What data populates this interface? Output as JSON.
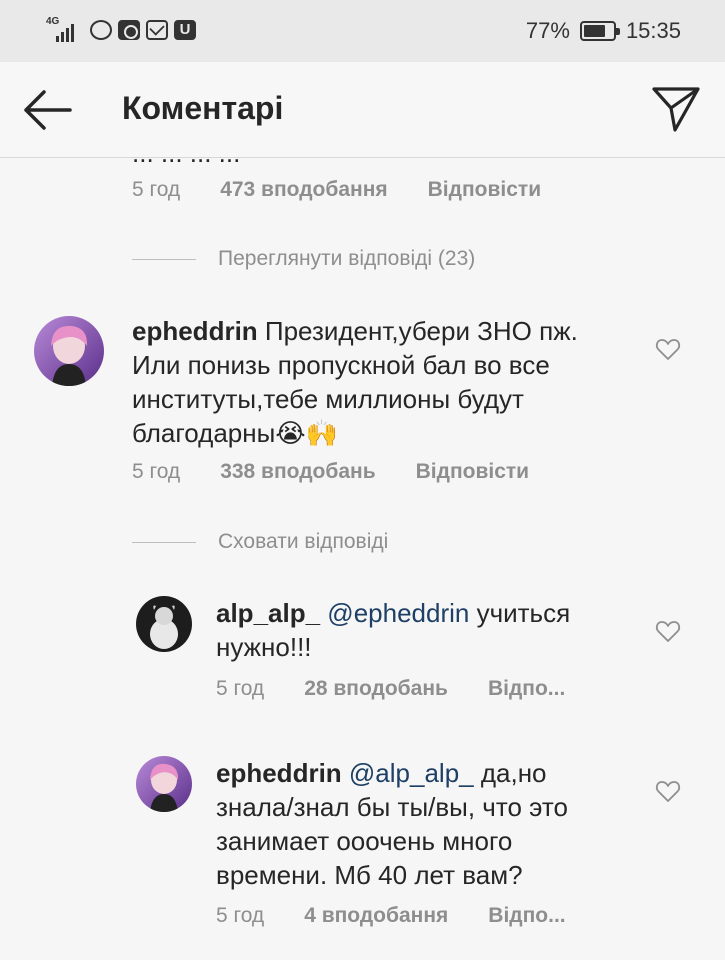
{
  "status_bar": {
    "network": "4G",
    "battery_percent": "77%",
    "battery_level": 0.77,
    "time": "15:35",
    "icons": [
      "signal-icon",
      "emoji-notification-icon",
      "ok-notification-icon",
      "mail-notification-icon",
      "u-notification-icon"
    ]
  },
  "header": {
    "title": "Коментарі",
    "back_icon": "arrow-left-icon",
    "send_icon": "paper-plane-icon"
  },
  "top_cut_comment": {
    "text_fragment": "... ... ... ...",
    "time": "5 год",
    "likes": "473 вподобання",
    "reply": "Відповісти"
  },
  "view_replies_label": "Переглянути відповіді (23)",
  "hide_replies_label": "Сховати відповіді",
  "comments": [
    {
      "username": "epheddrin",
      "text": "Президент,убери ЗНО  пж. Или понизь пропускной бал во все институты,тебе миллионы будут благодарны😭🙌",
      "time": "5 год",
      "likes": "338 вподобань",
      "reply": "Відповісти"
    }
  ],
  "replies": [
    {
      "username": "alp_alp_",
      "mention": "@epheddrin",
      "text": " учиться нужно!!!",
      "time": "5 год",
      "likes": "28 вподобань",
      "reply": "Відпо..."
    },
    {
      "username": "epheddrin",
      "mention": "@alp_alp_",
      "text": " да,но знала/знал бы ты/вы, что это занимает ооочень много времени. Мб 40 лет вам?",
      "time": "5 год",
      "likes": "4 вподобання",
      "reply": "Відпо..."
    }
  ],
  "colors": {
    "status_bar_bg": "#e9e9e9",
    "background": "#f6f6f6",
    "text": "#262626",
    "meta": "#8e8e8e",
    "mention": "#1e3f66"
  }
}
